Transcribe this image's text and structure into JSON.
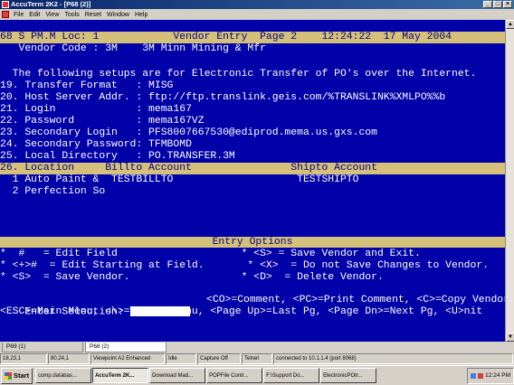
{
  "window": {
    "title": "AccuTerm 2K2 - [P68 (2)]"
  },
  "menu": [
    "File",
    "Edit",
    "View",
    "Tools",
    "Reset",
    "Window",
    "Help"
  ],
  "terminal": {
    "header": "68 S PM.M Loc: 1            Vendor Entry  Page 2    12:24:22  17 May 2004",
    "vendor_code": "   Vendor Code : 3M    3M Minn Mining & Mfr",
    "intro": "  The following setups are for Electronic Transfer of PO's over the Internet.",
    "fields": [
      "19. Transfer Format   : MISG",
      "20. Host Server Addr. : ftp://ftp.translink.geis.com/%TRANSLINK%XMLPO%%b",
      "21. Login             : mema167",
      "22. Password          : mema167VZ",
      "23. Secondary Login   : PFS8007667530@ediprod.mema.us.gxs.com",
      "24. Secondary Password: TFMBOMD",
      "25. Local Directory   : PO.TRANSFER.3M"
    ],
    "table_header": "26. Location     Billto Account                Shipto Account",
    "rows": [
      "  1 Auto Paint &  TESTBILLTO                    TESTSHIPTO",
      "  2 Perfection So"
    ],
    "entry_options_title": "Entry Options",
    "options": [
      "*  #   = Edit Field                    * <S> = Save Vendor and Exit.",
      "* <+>#  = Edit Starting at Field.       * <X>  = Do not Save Changes to Vendor.",
      "* <S>  = Save Vendor.                  * <D>  = Delete Vendor."
    ],
    "selection_label": "Enter Selection:",
    "selection_value": "",
    "help_line_1": "                  <CO>=Comment, <PC>=Print Comment, <C>=Copy Vendor",
    "help_line_2": "<ESC>=Main Menu, <\\>=Vendor Menu, <Page Up>=Last Pg, <Page Dn>=Next Pg, <U>nit"
  },
  "tabs": [
    "P69 (1)",
    "P68 (2)"
  ],
  "statusbar": [
    "18,23,1",
    "80,24,1",
    "Viewpoint A2 Enhanced",
    "Idle",
    "Capture Off",
    "Telnet",
    "connected to 10.1.1.4 (port 8068)"
  ],
  "taskbar": {
    "start": "Start",
    "buttons": [
      "comp.databas...",
      "AccuTerm 2K...",
      "Download Mad...",
      "POPFile Contr...",
      "F:\\Support Do...",
      "ElectronicPOtr..."
    ],
    "clock": "12:24 PM"
  }
}
